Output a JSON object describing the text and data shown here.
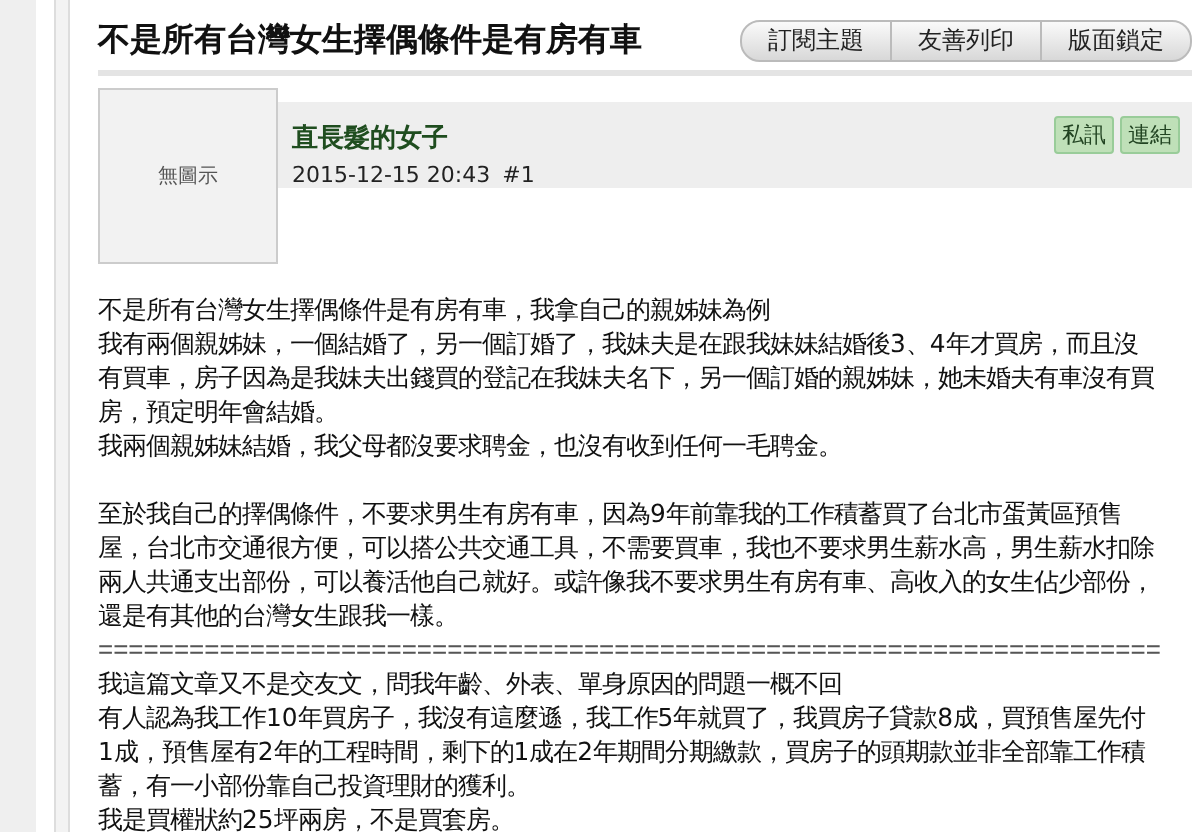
{
  "topic": {
    "title": "不是所有台灣女生擇偶條件是有房有車",
    "buttons": [
      "訂閱主題",
      "友善列印",
      "版面鎖定"
    ]
  },
  "post": {
    "avatar": {
      "placeholder": "無圖示"
    },
    "author": "直長髮的女子",
    "date": "2015-12-15 20:43",
    "floor": "#1",
    "actions": [
      "私訊",
      "連結"
    ],
    "body": [
      {
        "kind": "text",
        "lines": [
          "不是所有台灣女生擇偶條件是有房有車，我拿自己的親姊妹為例",
          "我有兩個親姊妹，一個結婚了，另一個訂婚了，我妹夫是在跟我妹妹結婚後3、4年才買房，而且沒有買車，房子因為是我妹夫出錢買的登記在我妹夫名下，另一個訂婚的親姊妹，她未婚夫有車沒有買房，預定明年會結婚。",
          "我兩個親姊妹結婚，我父母都沒要求聘金，也沒有收到任何一毛聘金。"
        ]
      },
      {
        "kind": "text",
        "lines": [
          "至於我自己的擇偶條件，不要求男生有房有車，因為9年前靠我的工作積蓄買了台北市蛋黃區預售屋，台北市交通很方便，可以搭公共交通工具，不需要買車，我也不要求男生薪水高，男生薪水扣除兩人共通支出部份，可以養活他自己就好。或許像我不要求男生有房有車、高收入的女生佔少部份，還是有其他的台灣女生跟我一樣。"
        ]
      },
      {
        "kind": "separator",
        "text": "======================================================================"
      },
      {
        "kind": "text",
        "lines": [
          "我這篇文章又不是交友文，問我年齡、外表、單身原因的問題一概不回",
          "有人認為我工作10年買房子，我沒有這麼遜，我工作5年就買了，我買房子貸款8成，買預售屋先付1成，預售屋有2年的工程時間，剩下的1成在2年期間分期繳款，買房子的頭期款並非全部靠工作積蓄，有一小部份靠自己投資理財的獲利。",
          "我是買權狀約25坪兩房，不是買套房。"
        ]
      }
    ]
  }
}
